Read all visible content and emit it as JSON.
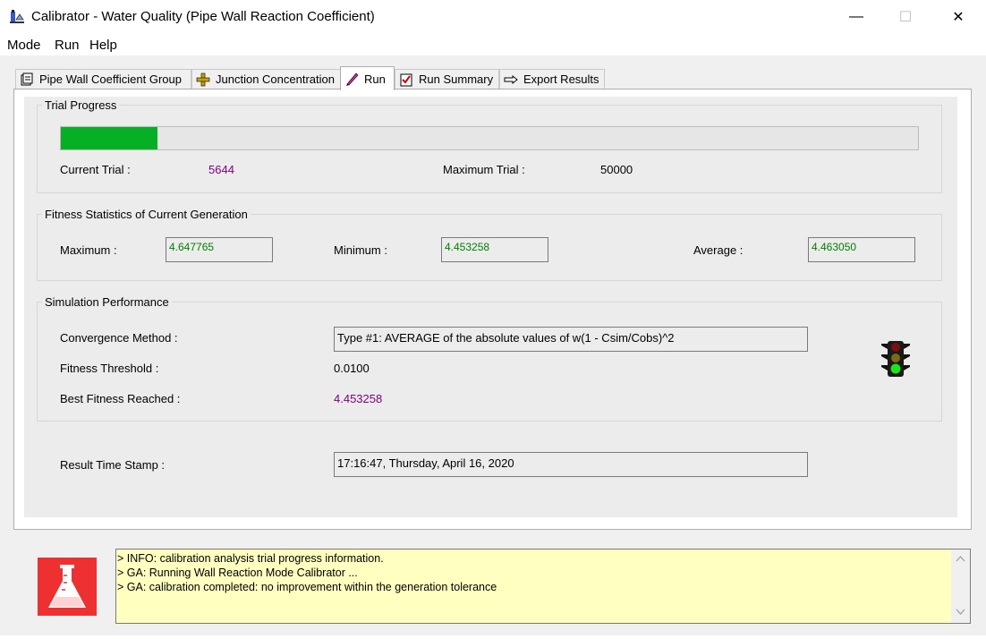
{
  "window": {
    "title": "Calibrator - Water Quality (Pipe Wall Reaction Coefficient)",
    "app_icon": "calibrator-app-icon",
    "minimize": "—",
    "maximize": "☐",
    "close": "✕"
  },
  "menu": {
    "items": [
      "Mode",
      "Run",
      "Help"
    ]
  },
  "tabs": [
    {
      "label": "Pipe Wall Coefficient Group",
      "icon": "pipe-group-icon",
      "active": false
    },
    {
      "label": "Junction Concentration",
      "icon": "junction-icon",
      "active": false
    },
    {
      "label": "Run",
      "icon": "run-pen-icon",
      "active": true
    },
    {
      "label": "Run Summary",
      "icon": "checklist-icon",
      "active": false
    },
    {
      "label": "Export Results",
      "icon": "export-hand-icon",
      "active": false
    }
  ],
  "trial_progress": {
    "title": "Trial Progress",
    "progress_fraction": 0.11288,
    "progress_color": "#06b025",
    "current_label": "Current Trial :",
    "current_value": "5644",
    "max_label": "Maximum Trial :",
    "max_value": "50000"
  },
  "fitness": {
    "title": "Fitness Statistics of Current Generation",
    "max_label": "Maximum :",
    "max_value": "4.647765",
    "min_label": "Minimum :",
    "min_value": "4.453258",
    "avg_label": "Average :",
    "avg_value": "4.463050"
  },
  "simulation": {
    "title": "Simulation Performance",
    "convergence_label": "Convergence Method :",
    "convergence_value": "Type #1: AVERAGE of the absolute values of w(1 - Csim/Cobs)^2",
    "threshold_label": "Fitness Threshold :",
    "threshold_value": "0.0100",
    "best_label": "Best Fitness Reached :",
    "best_value": "4.453258",
    "traffic_light": {
      "icon": "traffic-light-icon",
      "active": "green"
    }
  },
  "timestamp": {
    "label": "Result Time Stamp :",
    "value": "17:16:47, Thursday, April 16, 2020"
  },
  "log": {
    "icon": "flask-icon",
    "lines": [
      "> INFO: calibration analysis trial progress information.",
      "> GA: Running Wall Reaction Mode Calibrator ...",
      "> GA: calibration completed: no improvement within the generation tolerance"
    ]
  }
}
